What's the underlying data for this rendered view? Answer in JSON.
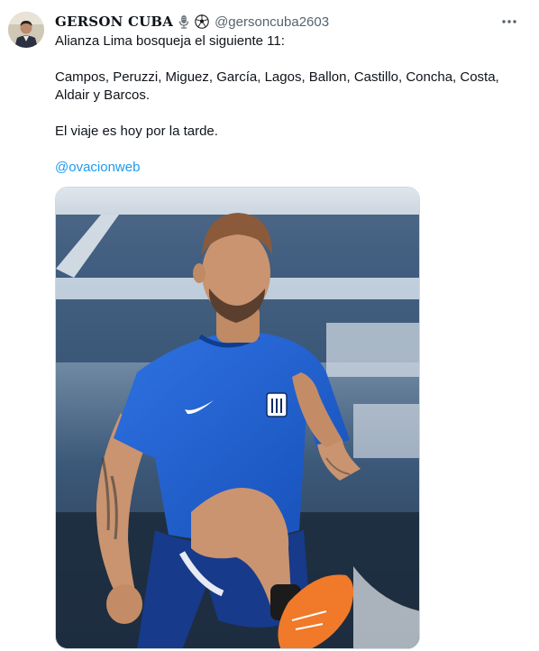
{
  "tweet": {
    "author_name": "GERSON CUBA",
    "author_emojis": [
      "microphone-emoji",
      "soccer-ball-emoji"
    ],
    "author_handle": "@gersoncuba2603",
    "more_icon": "more-horizontal-icon",
    "lines": [
      "Alianza Lima bosqueja el siguiente 11:",
      "Campos, Peruzzi, Miguez, García, Lagos, Ballon, Castillo, Concha, Costa,",
      "Aldair y Barcos.",
      "El viaje es hoy por la tarde."
    ],
    "mention": "@ovacionweb",
    "media": {
      "kind": "photo",
      "subject": "footballer-training-photo"
    }
  },
  "colors": {
    "text": "#0f1419",
    "secondary": "#536471",
    "link": "#1d9bf0",
    "border": "#cfd9de",
    "jersey": "#1f5fd6"
  }
}
